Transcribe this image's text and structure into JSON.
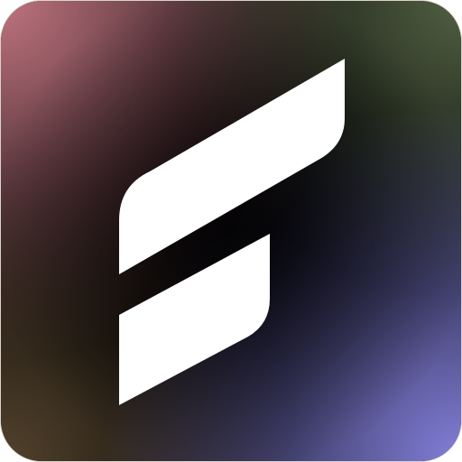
{
  "icon": {
    "logo": "stylized-letter-f-logo-icon",
    "colors": {
      "background": "#000000",
      "corner_top_left": "#c97a86",
      "corner_top_right": "#5a6a4a",
      "corner_bottom_left": "#5c4a32",
      "corner_bottom_right": "#8a86e6",
      "mark": "#ffffff"
    }
  }
}
